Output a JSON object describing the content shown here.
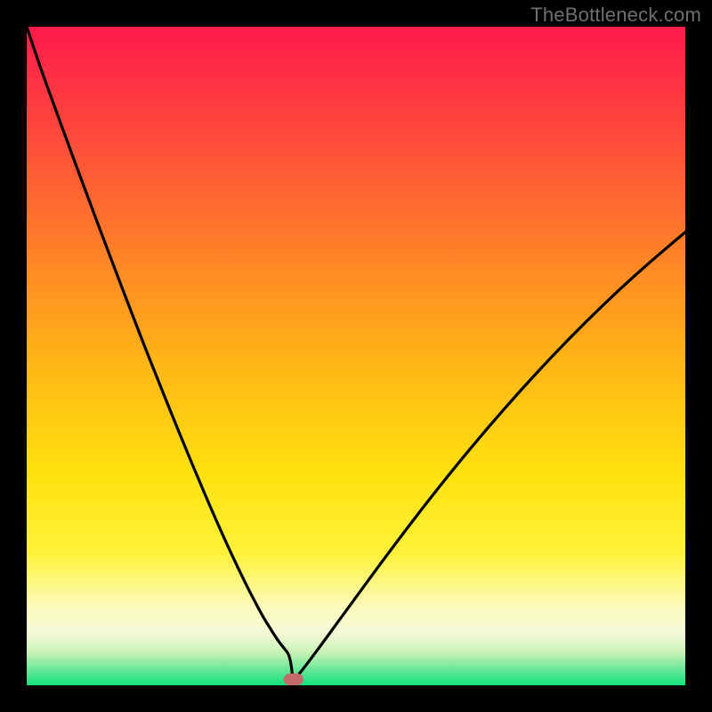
{
  "watermark": "TheBottleneck.com",
  "chart_data": {
    "type": "line",
    "title": "",
    "xlabel": "",
    "ylabel": "",
    "xlim": [
      0,
      100
    ],
    "ylim": [
      0,
      100
    ],
    "grid": false,
    "legend": false,
    "curve_note": "V-shaped bottleneck curve; minimum near x≈40.5, y≈0; left branch steeper than right",
    "x": [
      0,
      2,
      4,
      6,
      8,
      10,
      12,
      14,
      16,
      18,
      20,
      22,
      24,
      26,
      28,
      30,
      32,
      34,
      36,
      37,
      38,
      39,
      40,
      40.5,
      41,
      42,
      45,
      50,
      55,
      60,
      65,
      70,
      75,
      80,
      85,
      90,
      95,
      100
    ],
    "y": [
      100,
      94,
      88.5,
      83,
      77.6,
      72.2,
      66.9,
      61.6,
      56.4,
      51.2,
      46.2,
      41.2,
      36.3,
      31.5,
      26.8,
      22.3,
      18,
      13.9,
      10.2,
      8.6,
      7,
      5.7,
      4.5,
      0.1,
      1.3,
      2.5,
      6.5,
      13.4,
      20.2,
      26.8,
      33.1,
      39.1,
      44.8,
      50.2,
      55.3,
      60.1,
      64.6,
      68.8
    ],
    "marker_region": {
      "x": 40.5,
      "width": 3.0,
      "y": 0,
      "height": 1.8
    }
  },
  "colors": {
    "gradient_top": "#ff1a4b",
    "gradient_mid1": "#ff6a2a",
    "gradient_mid2": "#ffb016",
    "gradient_mid3": "#ffe712",
    "gradient_pale": "#fdfccf",
    "gradient_green": "#11e27a",
    "curve": "#000000",
    "marker": "#c46a6a",
    "watermark": "#6f6f6f"
  }
}
